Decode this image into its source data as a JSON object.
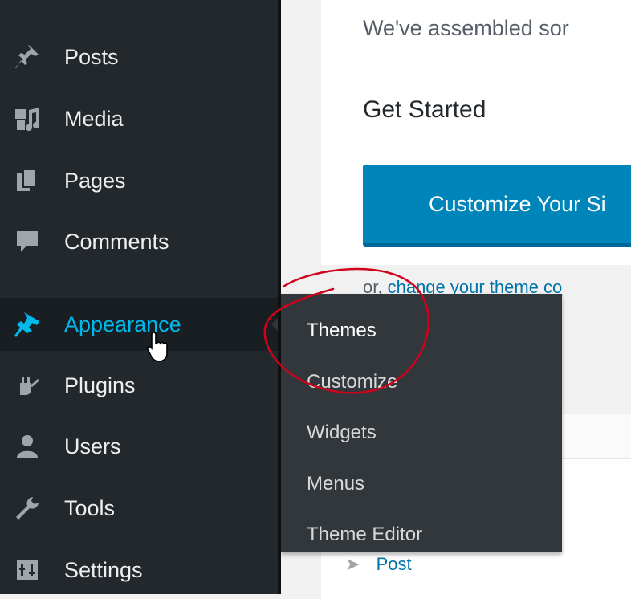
{
  "sidebar": {
    "items": [
      {
        "label": "Posts",
        "icon": "pin-icon"
      },
      {
        "label": "Media",
        "icon": "media-icon"
      },
      {
        "label": "Pages",
        "icon": "pages-icon"
      },
      {
        "label": "Comments",
        "icon": "comment-icon"
      },
      {
        "label": "Appearance",
        "icon": "paintbrush-icon",
        "active": true
      },
      {
        "label": "Plugins",
        "icon": "plugin-icon"
      },
      {
        "label": "Users",
        "icon": "user-icon"
      },
      {
        "label": "Tools",
        "icon": "wrench-icon"
      },
      {
        "label": "Settings",
        "icon": "settings-icon"
      }
    ]
  },
  "flyout": {
    "items": [
      {
        "label": "Themes"
      },
      {
        "label": "Customize"
      },
      {
        "label": "Widgets"
      },
      {
        "label": "Menus"
      },
      {
        "label": "Theme Editor"
      }
    ]
  },
  "main": {
    "intro": "We've assembled sor",
    "get_started": "Get Started",
    "customize_button": "Customize Your Si",
    "change_prefix": "or,",
    "change_link": "change your theme co",
    "post_link": "Post"
  },
  "colors": {
    "sidebar": "#23282d",
    "active_text": "#00b9eb",
    "primary_button": "#0085ba",
    "annotation": "#d0021b"
  }
}
